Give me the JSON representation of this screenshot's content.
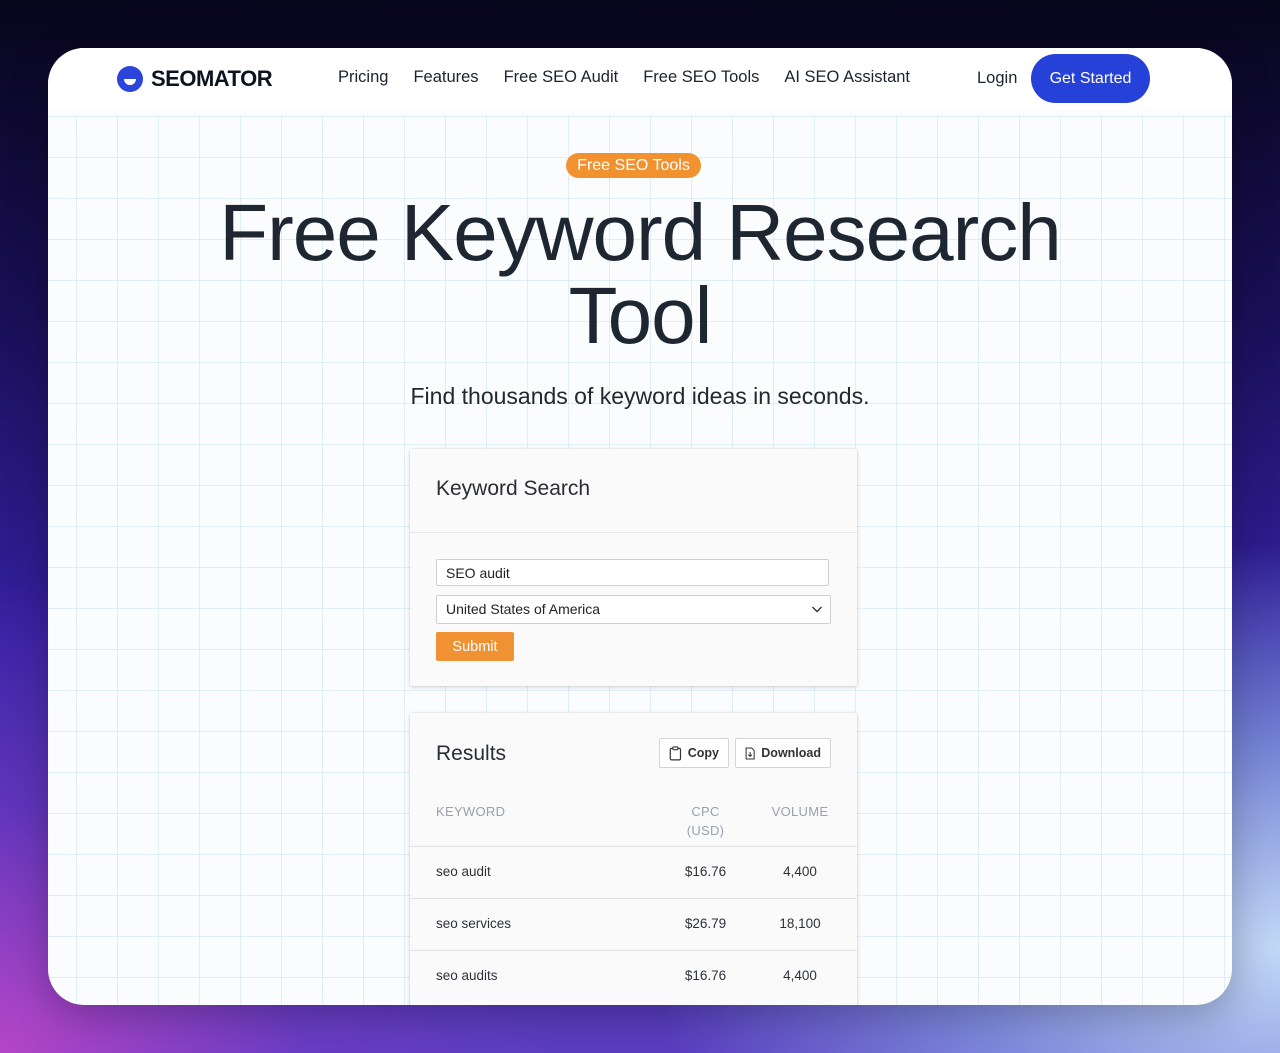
{
  "header": {
    "logo_text": "SEOMATOR",
    "nav": [
      "Pricing",
      "Features",
      "Free SEO Audit",
      "Free SEO Tools",
      "AI SEO Assistant"
    ],
    "login": "Login",
    "cta": "Get Started"
  },
  "hero": {
    "badge": "Free SEO Tools",
    "title": "Free Keyword Research Tool",
    "subtitle": "Find thousands of keyword ideas in seconds."
  },
  "search": {
    "title": "Keyword Search",
    "keyword_value": "SEO audit",
    "country_value": "United States of America",
    "submit_label": "Submit"
  },
  "results": {
    "title": "Results",
    "copy_label": "Copy",
    "download_label": "Download",
    "columns": {
      "keyword": "KEYWORD",
      "cpc_line1": "CPC",
      "cpc_line2": "(USD)",
      "volume": "VOLUME"
    },
    "rows": [
      {
        "keyword": "seo audit",
        "cpc": "$16.76",
        "volume": "4,400"
      },
      {
        "keyword": "seo services",
        "cpc": "$26.79",
        "volume": "18,100"
      },
      {
        "keyword": "seo audits",
        "cpc": "$16.76",
        "volume": "4,400"
      }
    ]
  },
  "colors": {
    "brand_blue": "#2641d8",
    "accent_orange": "#f09234",
    "heading_dark": "#1e2631"
  },
  "icons": [
    "clipboard-icon",
    "download-file-icon",
    "chevron-down-icon"
  ]
}
